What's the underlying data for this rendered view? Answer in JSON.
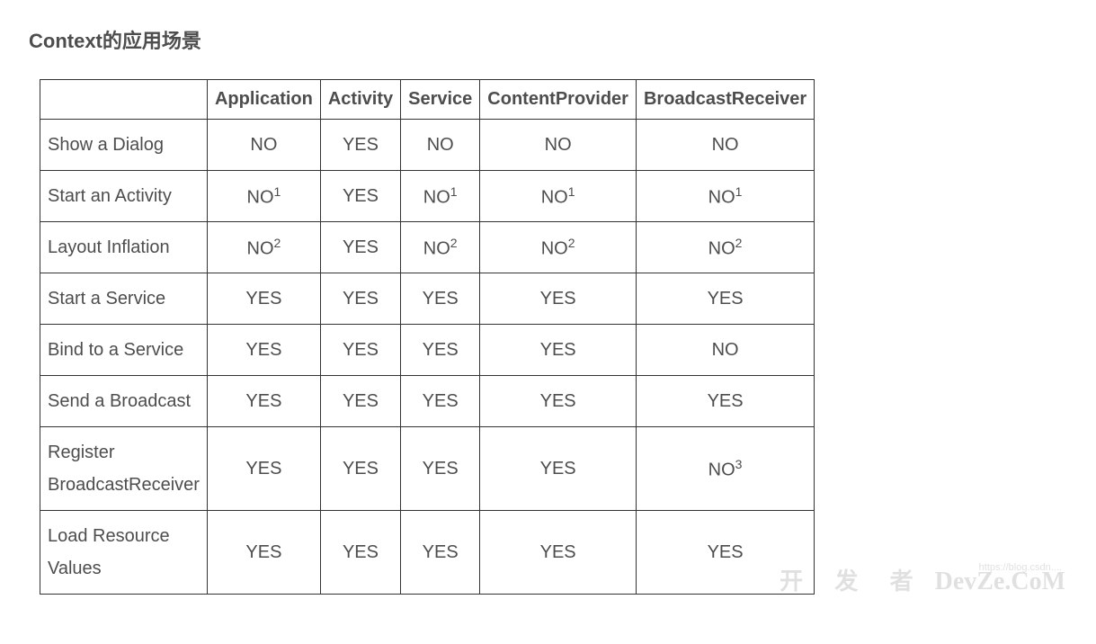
{
  "heading": "Context的应用场景",
  "chart_data": {
    "type": "table",
    "title": "Context的应用场景",
    "columns": [
      "",
      "Application",
      "Activity",
      "Service",
      "ContentProvider",
      "BroadcastReceiver"
    ],
    "rows": [
      {
        "label": "Show a Dialog",
        "cells": [
          {
            "v": "NO"
          },
          {
            "v": "YES"
          },
          {
            "v": "NO"
          },
          {
            "v": "NO"
          },
          {
            "v": "NO"
          }
        ]
      },
      {
        "label": "Start an Activity",
        "cells": [
          {
            "v": "NO",
            "sup": "1"
          },
          {
            "v": "YES"
          },
          {
            "v": "NO",
            "sup": "1"
          },
          {
            "v": "NO",
            "sup": "1"
          },
          {
            "v": "NO",
            "sup": "1"
          }
        ]
      },
      {
        "label": "Layout Inflation",
        "cells": [
          {
            "v": "NO",
            "sup": "2"
          },
          {
            "v": "YES"
          },
          {
            "v": "NO",
            "sup": "2"
          },
          {
            "v": "NO",
            "sup": "2"
          },
          {
            "v": "NO",
            "sup": "2"
          }
        ]
      },
      {
        "label": "Start a Service",
        "cells": [
          {
            "v": "YES"
          },
          {
            "v": "YES"
          },
          {
            "v": "YES"
          },
          {
            "v": "YES"
          },
          {
            "v": "YES"
          }
        ]
      },
      {
        "label": "Bind to a Service",
        "cells": [
          {
            "v": "YES"
          },
          {
            "v": "YES"
          },
          {
            "v": "YES"
          },
          {
            "v": "YES"
          },
          {
            "v": "NO"
          }
        ]
      },
      {
        "label": "Send a Broadcast",
        "cells": [
          {
            "v": "YES"
          },
          {
            "v": "YES"
          },
          {
            "v": "YES"
          },
          {
            "v": "YES"
          },
          {
            "v": "YES"
          }
        ]
      },
      {
        "label": "Register BroadcastReceiver",
        "cells": [
          {
            "v": "YES"
          },
          {
            "v": "YES"
          },
          {
            "v": "YES"
          },
          {
            "v": "YES"
          },
          {
            "v": "NO",
            "sup": "3"
          }
        ]
      },
      {
        "label": "Load Resource Values",
        "cells": [
          {
            "v": "YES"
          },
          {
            "v": "YES"
          },
          {
            "v": "YES"
          },
          {
            "v": "YES"
          },
          {
            "v": "YES"
          }
        ]
      }
    ]
  },
  "watermark": {
    "faint_url": "https://blog.csdn....",
    "brand_cn": "开 发 者",
    "brand_en": "DevZe.CoM"
  }
}
